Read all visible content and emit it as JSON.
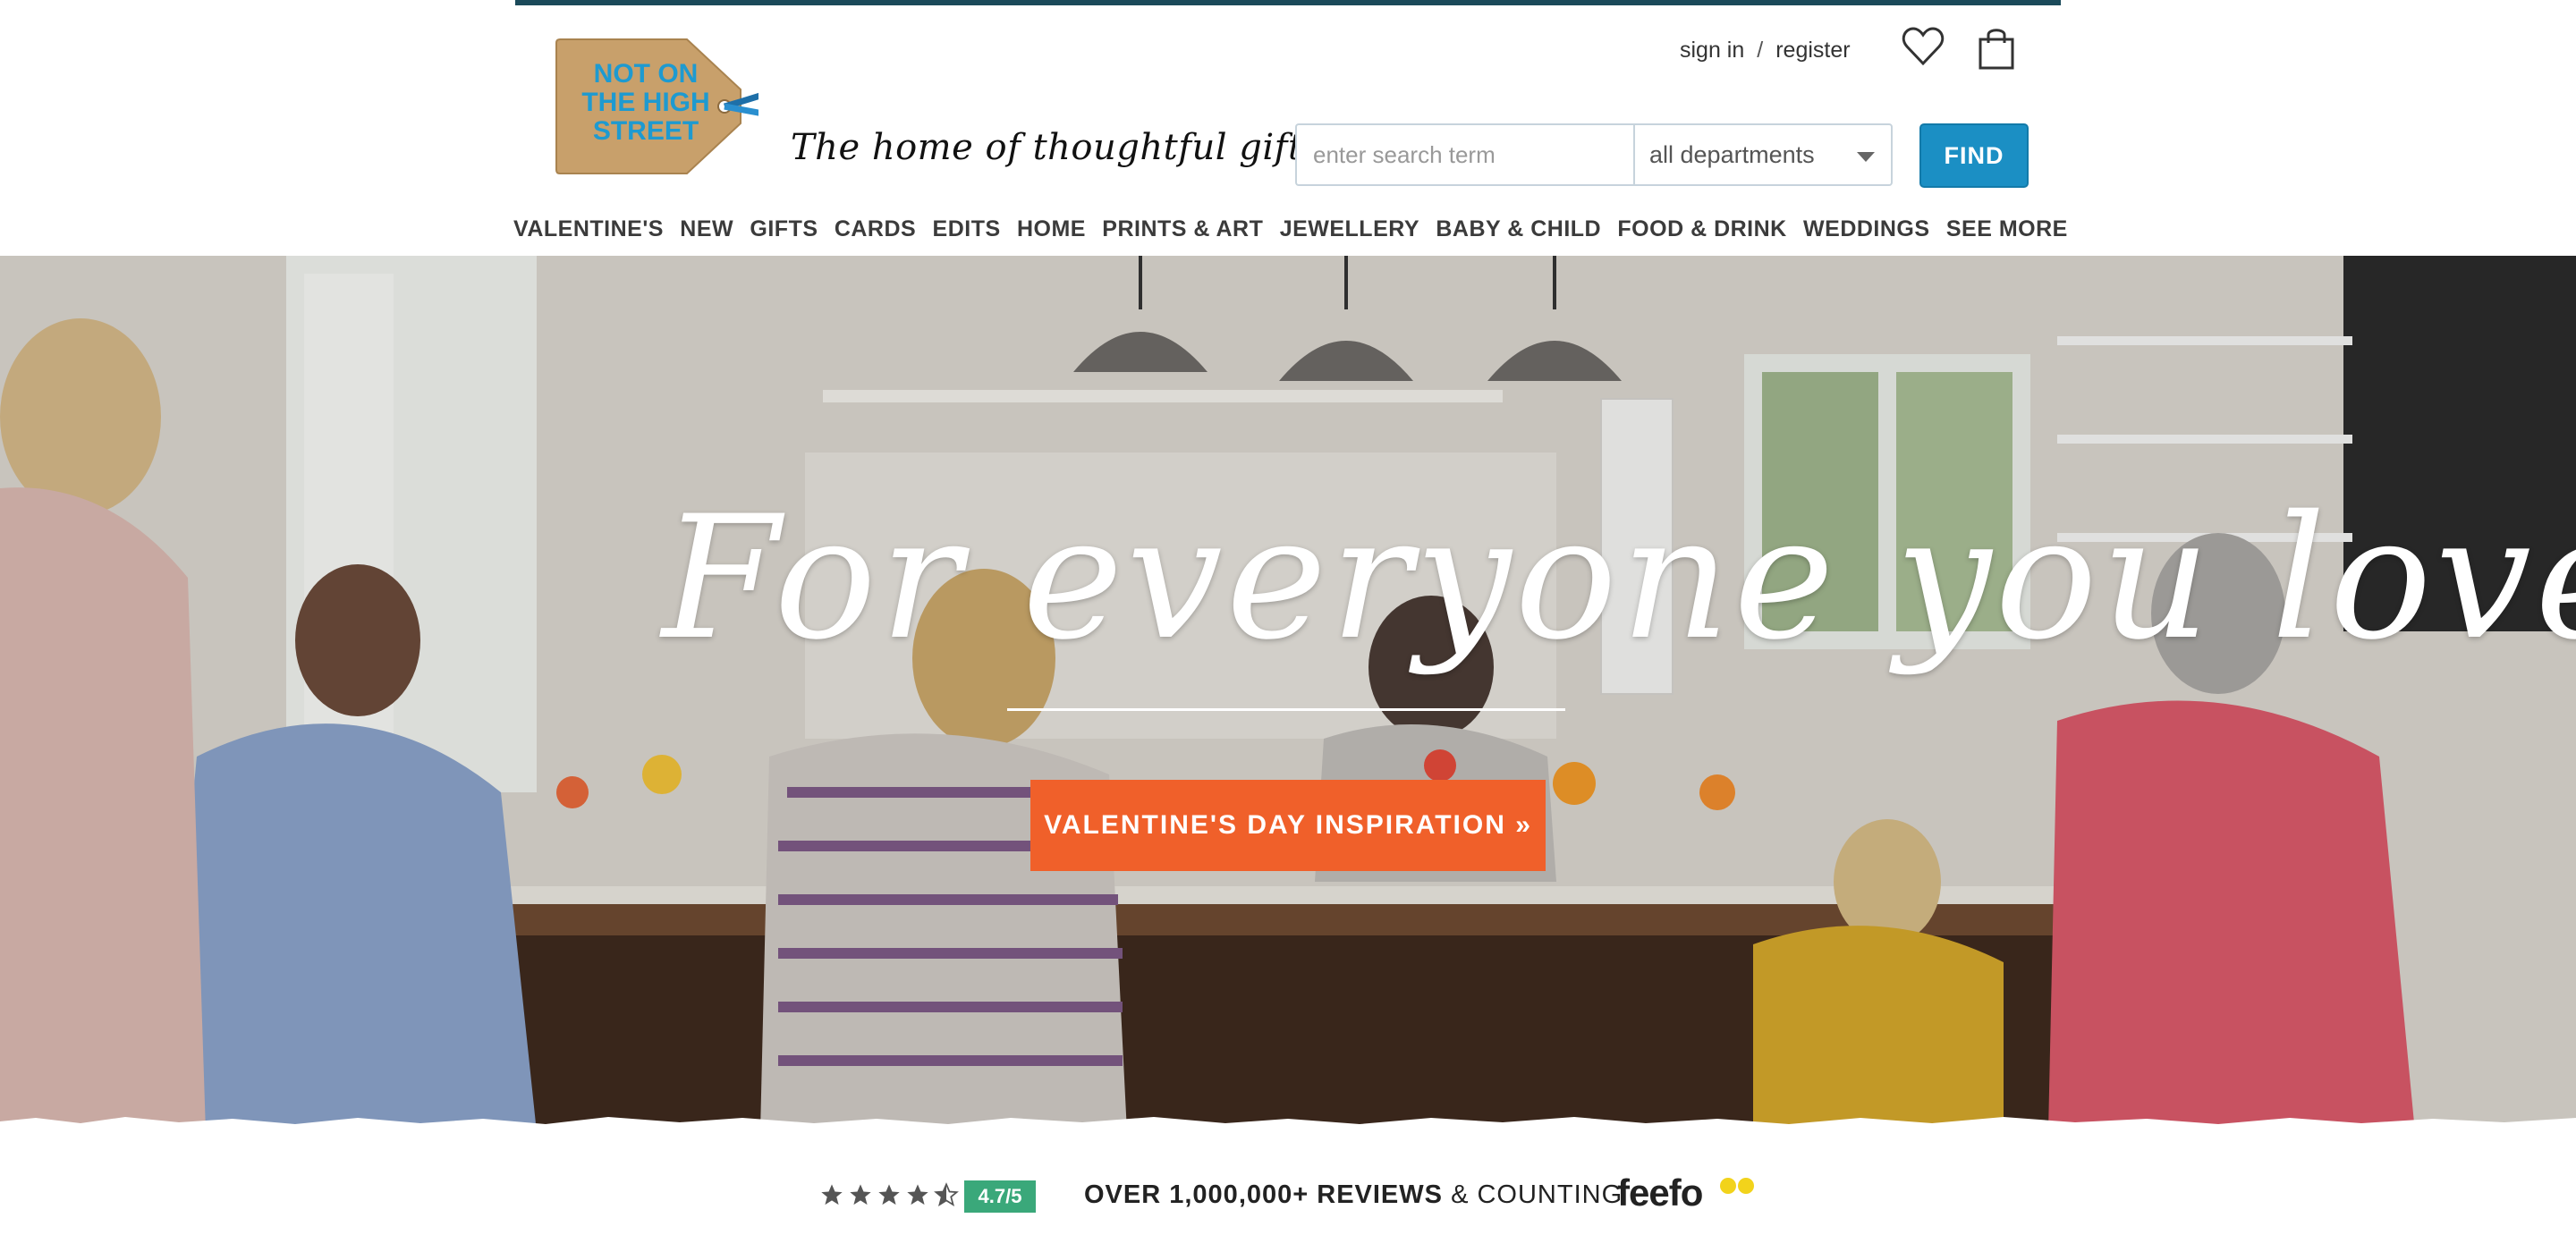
{
  "brand": {
    "logo_lines": [
      "NOT ON",
      "THE HIGH",
      "STREET"
    ],
    "tagline": "The home of thoughtful gifts",
    "colors": {
      "topbar": "#1b4a5a",
      "tag": "#c8a06b",
      "logo_text": "#1e9ad0"
    }
  },
  "account": {
    "sign_in": "sign in",
    "separator": "/",
    "register": "register",
    "wishlist_icon": "heart-icon",
    "basket_icon": "bag-icon"
  },
  "search": {
    "placeholder": "enter search term",
    "department": "all departments",
    "button": "FIND",
    "button_color": "#1b8fc4"
  },
  "nav": {
    "items": [
      "VALENTINE'S",
      "NEW",
      "GIFTS",
      "CARDS",
      "EDITS",
      "HOME",
      "PRINTS & ART",
      "JEWELLERY",
      "BABY & CHILD",
      "FOOD & DRINK",
      "WEDDINGS",
      "SEE MORE"
    ]
  },
  "hero": {
    "title": "For everyone you love",
    "cta": "VALENTINE'S DAY INSPIRATION »",
    "cta_color": "#f0602a"
  },
  "reviews": {
    "stars": 4.5,
    "rating": "4.7/5",
    "text_bold": "OVER 1,000,000+ REVIEWS",
    "text_rest": "& COUNTING",
    "provider": "feefo",
    "badge_color": "#3aa87a"
  }
}
